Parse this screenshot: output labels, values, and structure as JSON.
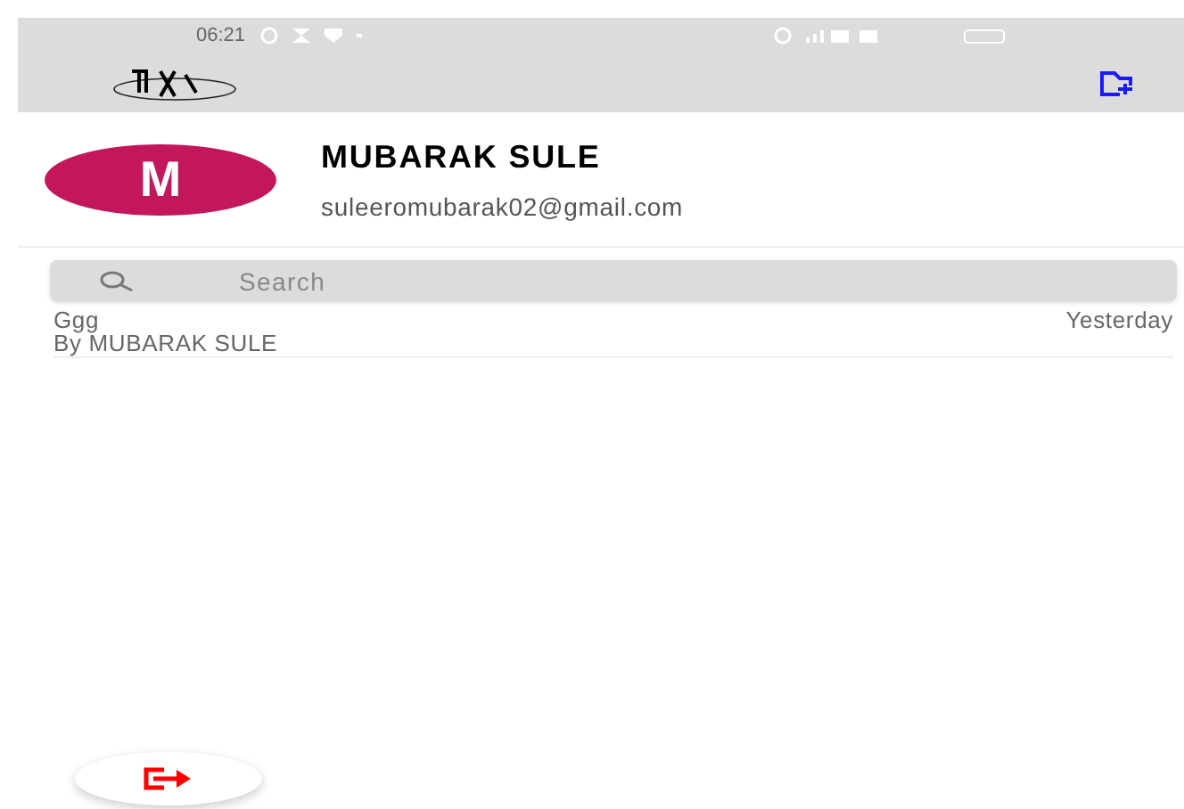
{
  "status_bar": {
    "time": "06:21"
  },
  "profile": {
    "initial": "M",
    "name": "MUBARAK SULE",
    "email": "suleeromubarak02@gmail.com"
  },
  "search": {
    "placeholder": "Search"
  },
  "posts": [
    {
      "title": "Ggg",
      "author": "By MUBARAK SULE",
      "time": "Yesterday"
    }
  ]
}
